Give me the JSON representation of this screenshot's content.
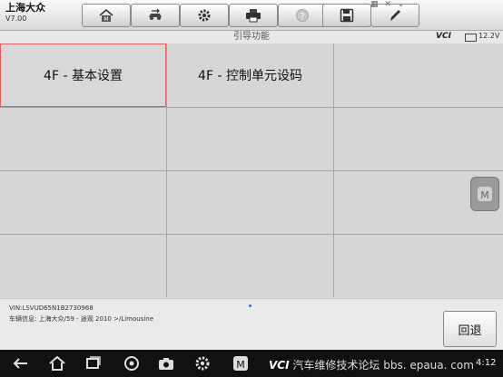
{
  "app": {
    "name": "上海大众",
    "version": "V7.00"
  },
  "toolbar": {
    "buttons": [
      {
        "icon": "home-m-icon"
      },
      {
        "icon": "car-swap-icon"
      },
      {
        "icon": "gear-icon"
      },
      {
        "icon": "printer-icon"
      },
      {
        "icon": "help-icon"
      },
      {
        "icon": "save-icon"
      },
      {
        "icon": "pen-icon"
      }
    ]
  },
  "titlebar": {
    "title": "引导功能",
    "vci": "VCI",
    "voltage": "12.2V"
  },
  "grid": {
    "cells": [
      {
        "label": "4F - 基本设置"
      },
      {
        "label": "4F - 控制单元设码"
      },
      {
        "label": ""
      },
      {
        "label": ""
      },
      {
        "label": ""
      },
      {
        "label": ""
      },
      {
        "label": ""
      },
      {
        "label": ""
      },
      {
        "label": ""
      },
      {
        "label": ""
      },
      {
        "label": ""
      },
      {
        "label": ""
      }
    ]
  },
  "info": {
    "vin": "VIN:LSVUD65N1B2730968",
    "vehicle": "车辆信息: 上海大众/59 - 途观 2010 >/Limousine",
    "back_label": "回退"
  },
  "navbar": {
    "watermark": "汽车维修技术论坛 bbs. epaua. com",
    "vci_label": "VCI",
    "time": "4:12"
  },
  "colors": {
    "accent": "#e06060",
    "dot": "#2c6cd8"
  }
}
